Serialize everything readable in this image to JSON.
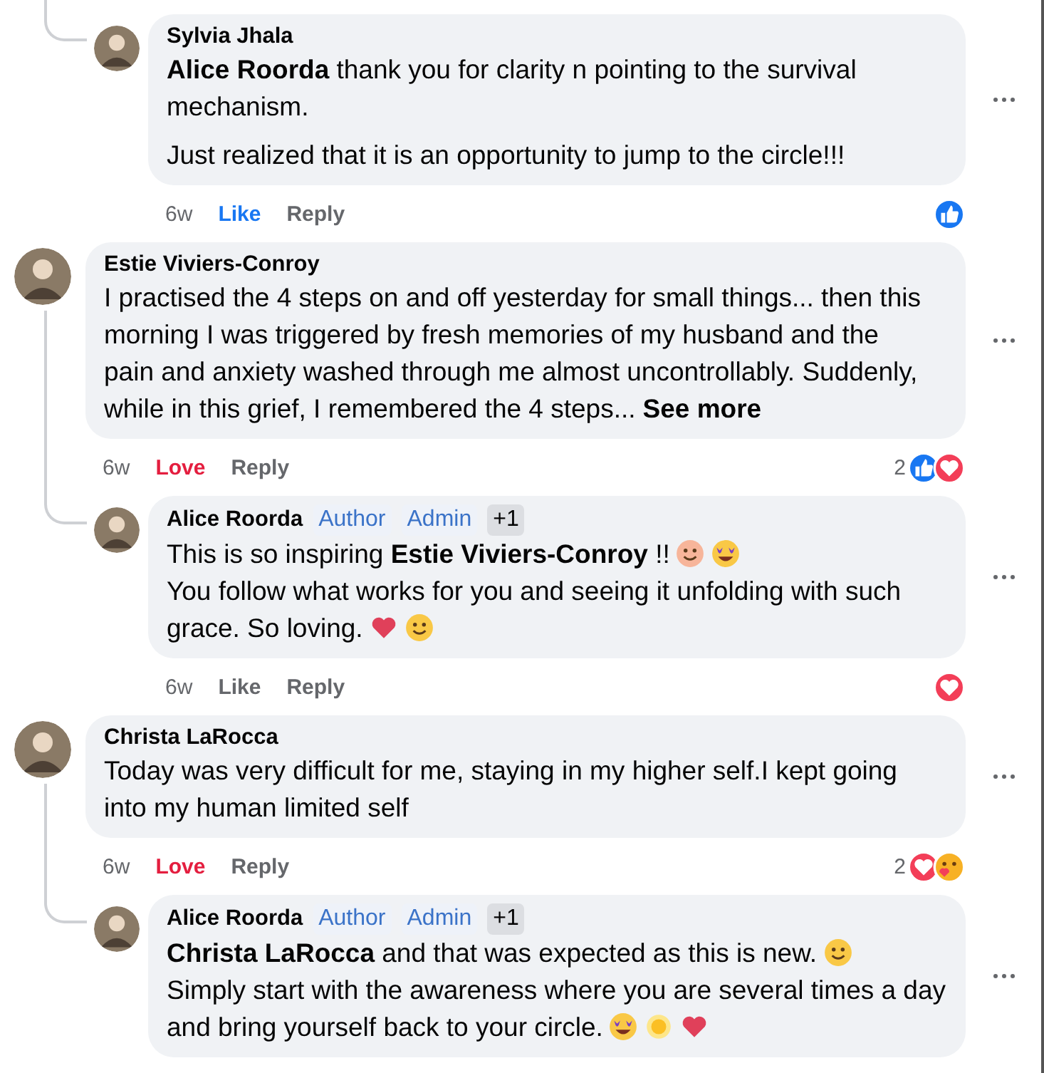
{
  "comments": [
    {
      "kind": "reply",
      "author": "Sylvia Jhala",
      "blocks": [
        {
          "kind": "paragraph",
          "lines": [
            "**Alice Roorda** thank you for clarity n pointing to the survival",
            "mechanism."
          ]
        },
        {
          "kind": "paragraph",
          "lines": [
            "Just realized that it is an opportunity to jump to the circle!!!"
          ]
        }
      ],
      "time": "6w",
      "reaction": {
        "label": "Like",
        "kind": "like"
      },
      "reply_label": "Reply",
      "summary": {
        "icons": [
          {
            "kind": "like"
          }
        ]
      }
    },
    {
      "kind": "comment",
      "author": "Estie Viviers-Conroy",
      "blocks": [
        {
          "kind": "line",
          "lines": [
            "I practised the 4 steps on and off yesterday for small things... then this",
            "morning I was triggered by fresh memories of my husband and the",
            "pain and anxiety washed through me almost uncontrollably. Suddenly,",
            "while in this grief, I remembered the 4 steps..."
          ],
          "link": "See more"
        }
      ],
      "time": "6w",
      "reaction": {
        "label": "Love",
        "kind": "love"
      },
      "reply_label": "Reply",
      "summary": {
        "count": "2",
        "icons": [
          {
            "kind": "like"
          },
          {
            "kind": "love"
          }
        ]
      }
    },
    {
      "kind": "reply",
      "author": "Alice Roorda",
      "badges": [
        {
          "label": "Author",
          "kind": "role"
        },
        {
          "label": "Admin",
          "kind": "role"
        },
        {
          "label": "+1",
          "kind": "count"
        }
      ],
      "blocks": [
        {
          "kind": "line",
          "lines": [
            "This is so inspiring **Estie Viviers-Conroy** !!"
          ],
          "icons": [
            {
              "kind": "blush"
            },
            {
              "kind": "starstruck"
            }
          ]
        },
        {
          "kind": "line",
          "lines": [
            "You follow what works for you and seeing it unfolding with such",
            "grace. So loving."
          ],
          "icons": [
            {
              "kind": "heart"
            },
            {
              "kind": "smile"
            }
          ]
        }
      ],
      "time": "6w",
      "reaction": {
        "label": "Like",
        "kind": "none"
      },
      "reply_label": "Reply",
      "summary": {
        "icons": [
          {
            "kind": "love"
          }
        ]
      }
    },
    {
      "kind": "comment",
      "author": "Christa LaRocca",
      "blocks": [
        {
          "kind": "line",
          "lines": [
            "Today was very difficult for me, staying in my higher self.I kept going",
            "into my human limited self"
          ]
        }
      ],
      "time": "6w",
      "reaction": {
        "label": "Love",
        "kind": "love"
      },
      "reply_label": "Reply",
      "summary": {
        "count": "2",
        "icons": [
          {
            "kind": "love"
          },
          {
            "kind": "care"
          }
        ]
      }
    },
    {
      "kind": "reply",
      "author": "Alice Roorda",
      "badges": [
        {
          "label": "Author",
          "kind": "role"
        },
        {
          "label": "Admin",
          "kind": "role"
        },
        {
          "label": "+1",
          "kind": "count"
        }
      ],
      "blocks": [
        {
          "kind": "line",
          "lines": [
            "**Christa LaRocca** and that was expected as this is new."
          ],
          "icons": [
            {
              "kind": "smile"
            }
          ]
        },
        {
          "kind": "line",
          "lines": [
            "Simply start with the awareness where you are several times a day",
            "and bring yourself back to your circle."
          ],
          "icons": [
            {
              "kind": "starstruck"
            },
            {
              "kind": "sun"
            },
            {
              "kind": "heart"
            }
          ]
        }
      ]
    }
  ]
}
